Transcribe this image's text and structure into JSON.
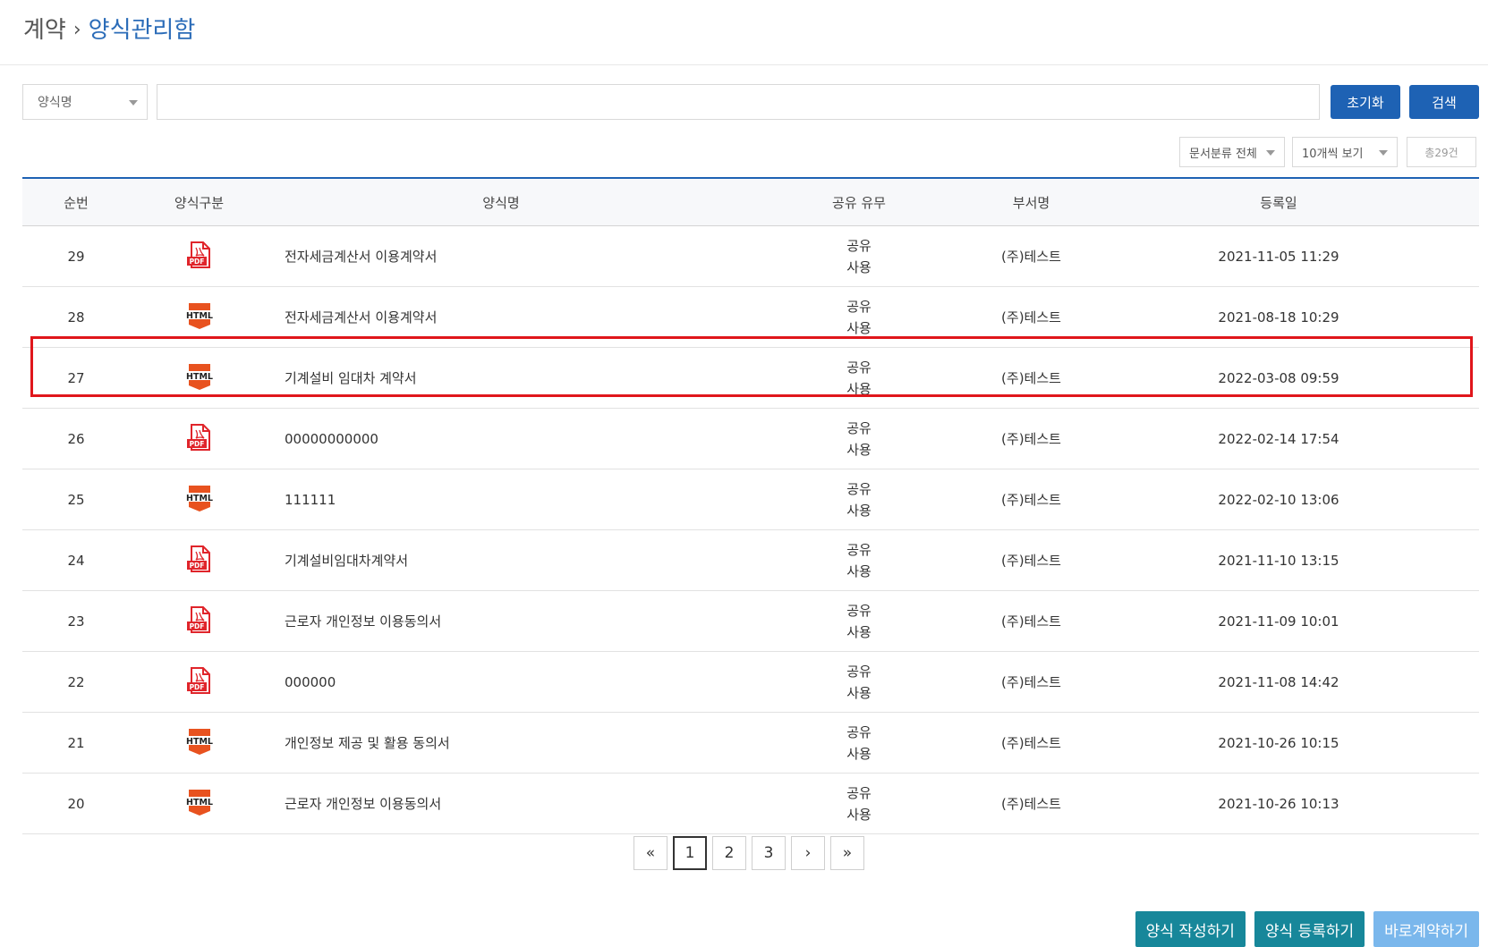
{
  "breadcrumb": {
    "parent": "계약",
    "separator": "›",
    "current": "양식관리함"
  },
  "search": {
    "field_select": "양식명",
    "input_value": "",
    "reset_label": "초기화",
    "search_label": "검색"
  },
  "filters": {
    "category": "문서분류 전체",
    "page_size": "10개씩 보기",
    "total": "총29건"
  },
  "table": {
    "headers": [
      "순번",
      "양식구분",
      "양식명",
      "공유 유무",
      "부서명",
      "등록일"
    ],
    "rows": [
      {
        "no": "29",
        "type": "PDF",
        "name": "전자세금계산서 이용계약서",
        "share1": "공유",
        "share2": "사용",
        "dept": "(주)테스트",
        "date": "2021-11-05 11:29"
      },
      {
        "no": "28",
        "type": "HTML",
        "name": "전자세금계산서 이용계약서",
        "share1": "공유",
        "share2": "사용",
        "dept": "(주)테스트",
        "date": "2021-08-18 10:29"
      },
      {
        "no": "27",
        "type": "HTML",
        "name": "기계설비 임대차 계약서",
        "share1": "공유",
        "share2": "사용",
        "dept": "(주)테스트",
        "date": "2022-03-08 09:59"
      },
      {
        "no": "26",
        "type": "PDF",
        "name": "00000000000",
        "share1": "공유",
        "share2": "사용",
        "dept": "(주)테스트",
        "date": "2022-02-14 17:54"
      },
      {
        "no": "25",
        "type": "HTML",
        "name": "111111",
        "share1": "공유",
        "share2": "사용",
        "dept": "(주)테스트",
        "date": "2022-02-10 13:06"
      },
      {
        "no": "24",
        "type": "PDF",
        "name": "기계설비임대차계약서",
        "share1": "공유",
        "share2": "사용",
        "dept": "(주)테스트",
        "date": "2021-11-10 13:15"
      },
      {
        "no": "23",
        "type": "PDF",
        "name": "근로자 개인정보 이용동의서",
        "share1": "공유",
        "share2": "사용",
        "dept": "(주)테스트",
        "date": "2021-11-09 10:01"
      },
      {
        "no": "22",
        "type": "PDF",
        "name": "000000",
        "share1": "공유",
        "share2": "사용",
        "dept": "(주)테스트",
        "date": "2021-11-08 14:42"
      },
      {
        "no": "21",
        "type": "HTML",
        "name": "개인정보 제공 및 활용 동의서",
        "share1": "공유",
        "share2": "사용",
        "dept": "(주)테스트",
        "date": "2021-10-26 10:15"
      },
      {
        "no": "20",
        "type": "HTML",
        "name": "근로자 개인정보 이용동의서",
        "share1": "공유",
        "share2": "사용",
        "dept": "(주)테스트",
        "date": "2021-10-26 10:13"
      }
    ]
  },
  "icons": {
    "pdf_label": "PDF",
    "html_label": "HTML",
    "pdf_color": "#e0252b",
    "html_color": "#e8521f"
  },
  "pagination": {
    "first": "«",
    "prev": "‹",
    "next": "›",
    "last": "»",
    "pages": [
      "1",
      "2",
      "3"
    ],
    "current": "1"
  },
  "actions": {
    "write": "양식 작성하기",
    "register": "양식 등록하기",
    "direct": "바로계약하기"
  }
}
